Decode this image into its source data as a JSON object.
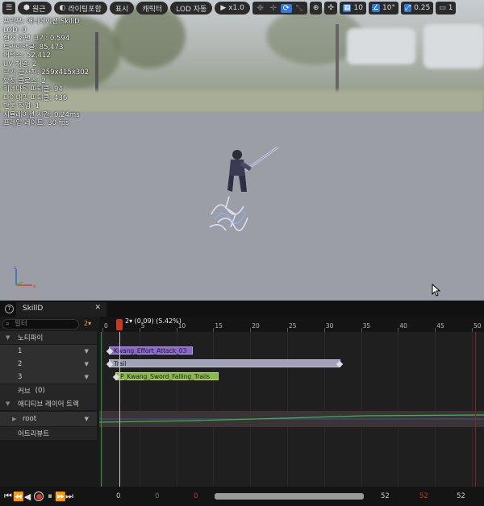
{
  "toolbar": {
    "menu_icon": "hamburger-icon",
    "perspective": "원근",
    "lighting": "라이팅포함",
    "show": "표시",
    "character": "캐릭터",
    "lod": "LOD 자동",
    "playback_speed": "x1.0",
    "grid_snap": "10",
    "rotation_snap": "10°",
    "scale_snap": "0.25",
    "camera_count": "1"
  },
  "stats": [
    "프리뷰: 애니메이션 SkillD",
    "LOD: 0",
    "현재 화면 크기: 0.594",
    "트라이앵글: 85,473",
    "버텍스: 52,412",
    "UV 채널: 2",
    "크기 근사치: 259x415x302",
    "활성 클로스: 2",
    "키네마틱 파티클: 94",
    "다이내믹 파티클: 436",
    "반복 작업: 1",
    "시뮬레이션 시간: 0.24ms",
    "프레임 레이트: 30 fps"
  ],
  "panel": {
    "tab_label": "SkillD",
    "filter_placeholder": "필터",
    "frame_indicator": "2▾",
    "playhead_label": "2▾ (0.09) (5.42%)",
    "rows": {
      "notifies": "노티파이",
      "track1": "1",
      "track2": "2",
      "track3": "3",
      "curves": "커브",
      "curves_count": "(0)",
      "additive_layers": "애디티브 레이어 트랙",
      "root": "root",
      "attributes": "어트리뷰트"
    },
    "ruler_ticks": [
      "0",
      "5",
      "10",
      "15",
      "20",
      "25",
      "30",
      "35",
      "40",
      "45",
      "50"
    ],
    "notify_events": [
      {
        "label": "Kwang_Effort_Attack_03",
        "color": "#8a66d1"
      },
      {
        "label": "Trail",
        "color": "#a1a1b8"
      },
      {
        "label": "P_Kwang_Sword_Falling_Trails",
        "color": "#8bb84a"
      }
    ]
  },
  "footer": {
    "start_frame": "0",
    "green_frame": "0",
    "red_frame": "0",
    "view_end": "52",
    "end_red": "52",
    "end_frame": "52"
  }
}
